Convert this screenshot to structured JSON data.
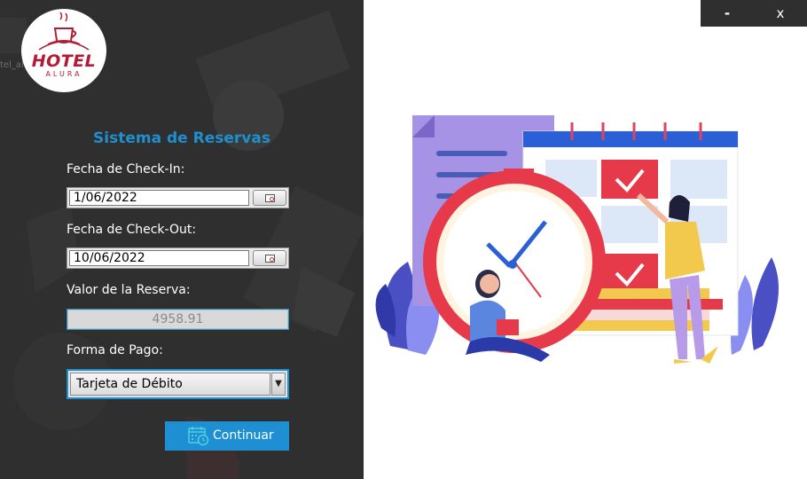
{
  "window": {
    "minimize_label": "-",
    "close_label": "x"
  },
  "logo": {
    "text": "HOTEL",
    "subtext": "ALURA"
  },
  "stray_text": "tel_al",
  "form": {
    "title": "Sistema de Reservas",
    "checkin_label": "Fecha de Check-In:",
    "checkin_value": "1/06/2022",
    "checkout_label": "Fecha de Check-Out:",
    "checkout_value": "10/06/2022",
    "value_label": "Valor de la Reserva:",
    "value": "4958.91",
    "payment_label": "Forma de Pago:",
    "payment_selected": "Tarjeta de Débito",
    "continue_label": "Continuar"
  },
  "colors": {
    "accent": "#1e90cf",
    "panel": "#2f2f2f",
    "brand": "#b31b34"
  }
}
